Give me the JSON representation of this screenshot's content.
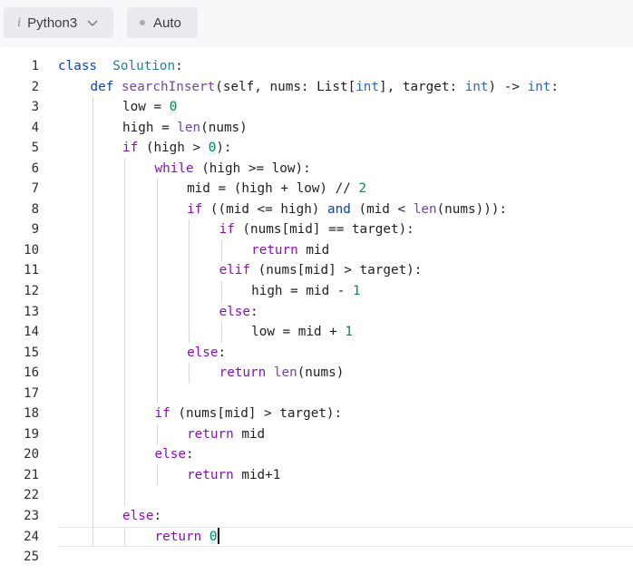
{
  "toolbar": {
    "language_prefix": "i",
    "language_label": "Python3",
    "mode_label": "Auto"
  },
  "editor": {
    "current_line": 24,
    "line_numbers": [
      "1",
      "2",
      "3",
      "4",
      "5",
      "6",
      "7",
      "8",
      "9",
      "10",
      "11",
      "12",
      "13",
      "14",
      "15",
      "16",
      "17",
      "18",
      "19",
      "20",
      "21",
      "22",
      "23",
      "24",
      "25"
    ],
    "lines": [
      {
        "indent": 0,
        "tokens": [
          [
            "kw2",
            "class"
          ],
          [
            "",
            "  "
          ],
          [
            "cls",
            "Solution"
          ],
          [
            "",
            ":"
          ]
        ]
      },
      {
        "indent": 1,
        "tokens": [
          [
            "kw2",
            "def"
          ],
          [
            "",
            " "
          ],
          [
            "fn",
            "searchInsert"
          ],
          [
            "",
            "(self, nums: List["
          ],
          [
            "ty",
            "int"
          ],
          [
            "",
            "], target: "
          ],
          [
            "ty",
            "int"
          ],
          [
            "",
            ") -> "
          ],
          [
            "ty",
            "int"
          ],
          [
            "",
            ":"
          ]
        ]
      },
      {
        "indent": 2,
        "tokens": [
          [
            "",
            "low = "
          ],
          [
            "num-hl",
            "0"
          ]
        ]
      },
      {
        "indent": 2,
        "tokens": [
          [
            "",
            "high = "
          ],
          [
            "fn",
            "len"
          ],
          [
            "",
            "(nums)"
          ]
        ]
      },
      {
        "indent": 2,
        "tokens": [
          [
            "kw",
            "if"
          ],
          [
            "",
            " (high > "
          ],
          [
            "num-hl",
            "0"
          ],
          [
            "",
            "):"
          ]
        ]
      },
      {
        "indent": 3,
        "tokens": [
          [
            "kw",
            "while"
          ],
          [
            "",
            " (high >= low):"
          ]
        ]
      },
      {
        "indent": 4,
        "tokens": [
          [
            "",
            "mid = (high + low) // "
          ],
          [
            "num",
            "2"
          ]
        ]
      },
      {
        "indent": 4,
        "tokens": [
          [
            "kw",
            "if"
          ],
          [
            "",
            " ((mid <= high) "
          ],
          [
            "kw2",
            "and"
          ],
          [
            "",
            " (mid < "
          ],
          [
            "fn",
            "len"
          ],
          [
            "",
            "(nums))):"
          ]
        ]
      },
      {
        "indent": 5,
        "tokens": [
          [
            "kw",
            "if"
          ],
          [
            "",
            " (nums[mid] == target):"
          ]
        ]
      },
      {
        "indent": 6,
        "tokens": [
          [
            "kw",
            "return"
          ],
          [
            "",
            " mid"
          ]
        ]
      },
      {
        "indent": 5,
        "tokens": [
          [
            "kw",
            "elif"
          ],
          [
            "",
            " (nums[mid] > target):"
          ]
        ]
      },
      {
        "indent": 6,
        "tokens": [
          [
            "",
            "high = mid - "
          ],
          [
            "num",
            "1"
          ]
        ]
      },
      {
        "indent": 5,
        "tokens": [
          [
            "kw",
            "else"
          ],
          [
            "",
            ":"
          ]
        ]
      },
      {
        "indent": 6,
        "tokens": [
          [
            "",
            "low = mid + "
          ],
          [
            "num",
            "1"
          ]
        ]
      },
      {
        "indent": 4,
        "tokens": [
          [
            "kw",
            "else"
          ],
          [
            "",
            ":"
          ]
        ]
      },
      {
        "indent": 5,
        "tokens": [
          [
            "kw",
            "return"
          ],
          [
            "",
            " "
          ],
          [
            "fn",
            "len"
          ],
          [
            "",
            "(nums)"
          ]
        ]
      },
      {
        "indent": 0,
        "guides": 3,
        "tokens": []
      },
      {
        "indent": 3,
        "tokens": [
          [
            "kw",
            "if"
          ],
          [
            "",
            " (nums[mid] > target):"
          ]
        ]
      },
      {
        "indent": 4,
        "tokens": [
          [
            "kw",
            "return"
          ],
          [
            "",
            " mid"
          ]
        ]
      },
      {
        "indent": 3,
        "tokens": [
          [
            "kw",
            "else"
          ],
          [
            "",
            ":"
          ]
        ]
      },
      {
        "indent": 4,
        "tokens": [
          [
            "kw",
            "return"
          ],
          [
            "",
            " mid+1"
          ]
        ]
      },
      {
        "indent": 0,
        "guides": 2,
        "tokens": []
      },
      {
        "indent": 2,
        "tokens": [
          [
            "kw",
            "else"
          ],
          [
            "",
            ":"
          ]
        ]
      },
      {
        "indent": 3,
        "tokens": [
          [
            "kw",
            "return"
          ],
          [
            "",
            " "
          ],
          [
            "num-hl",
            "0"
          ]
        ],
        "caret": true
      },
      {
        "indent": 0,
        "tokens": []
      }
    ]
  }
}
